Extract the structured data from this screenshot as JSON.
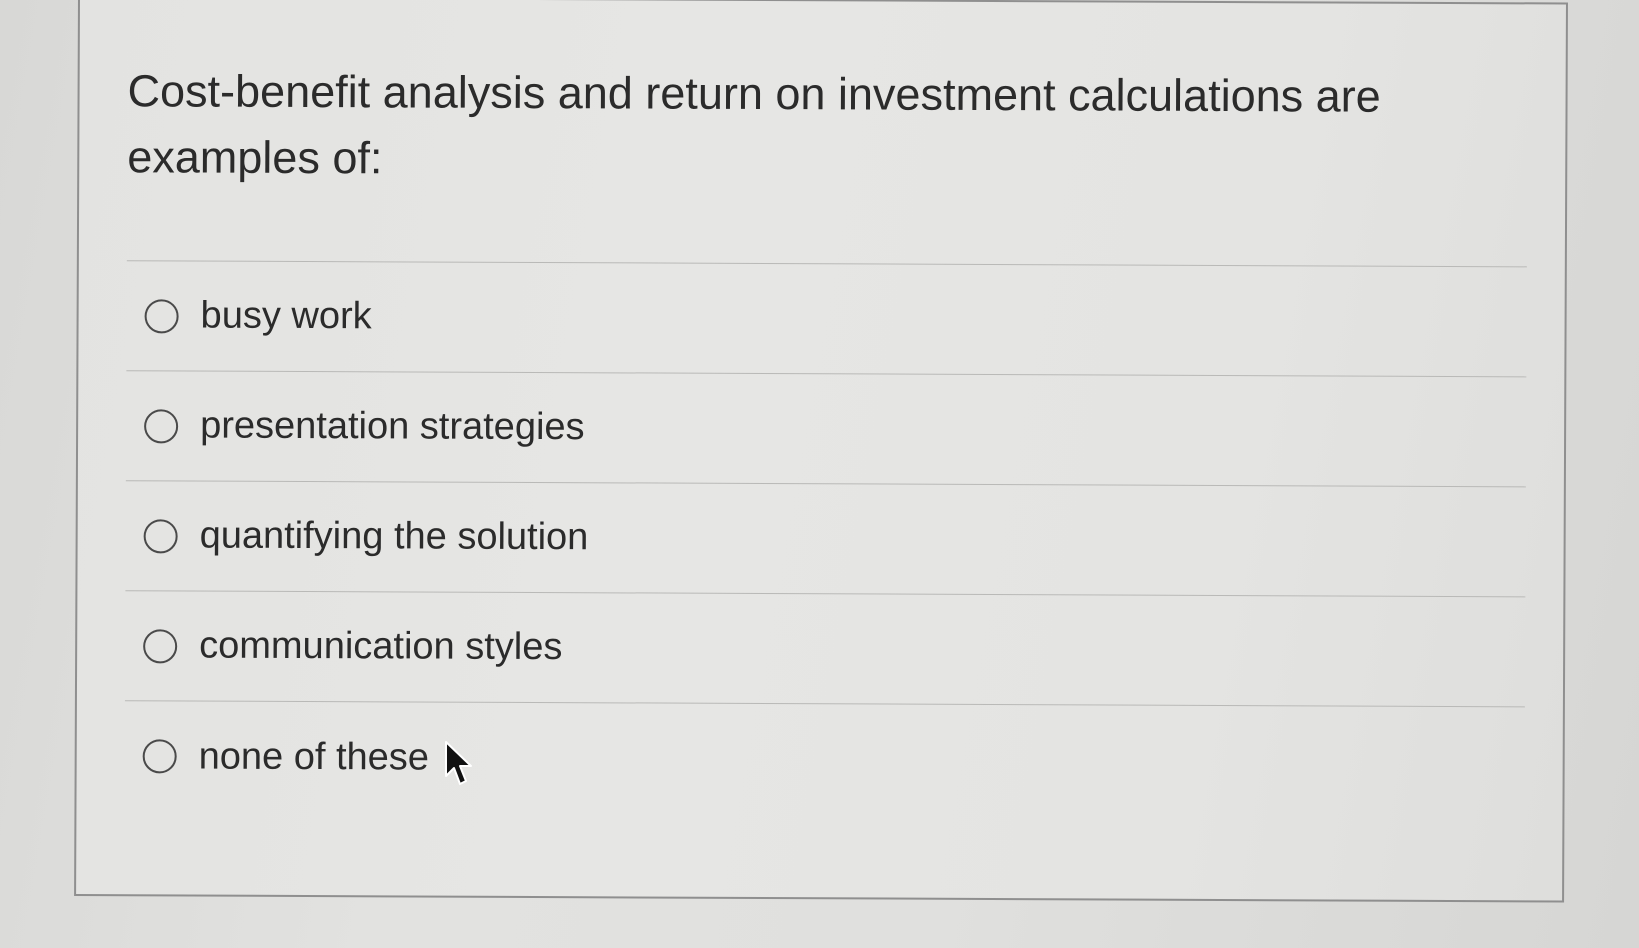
{
  "question": {
    "text": "Cost-benefit analysis and return on investment calculations are examples of:"
  },
  "options": [
    {
      "label": "busy work"
    },
    {
      "label": "presentation strategies"
    },
    {
      "label": "quantifying the solution"
    },
    {
      "label": "communication styles"
    },
    {
      "label": "none of these"
    }
  ],
  "icons": {
    "radio": "radio-unselected-icon",
    "cursor": "mouse-pointer-icon"
  },
  "colors": {
    "background": "#dcdcda",
    "text": "#2b2b2b",
    "border": "#8f8f8f",
    "divider": "#b9b9b7"
  }
}
